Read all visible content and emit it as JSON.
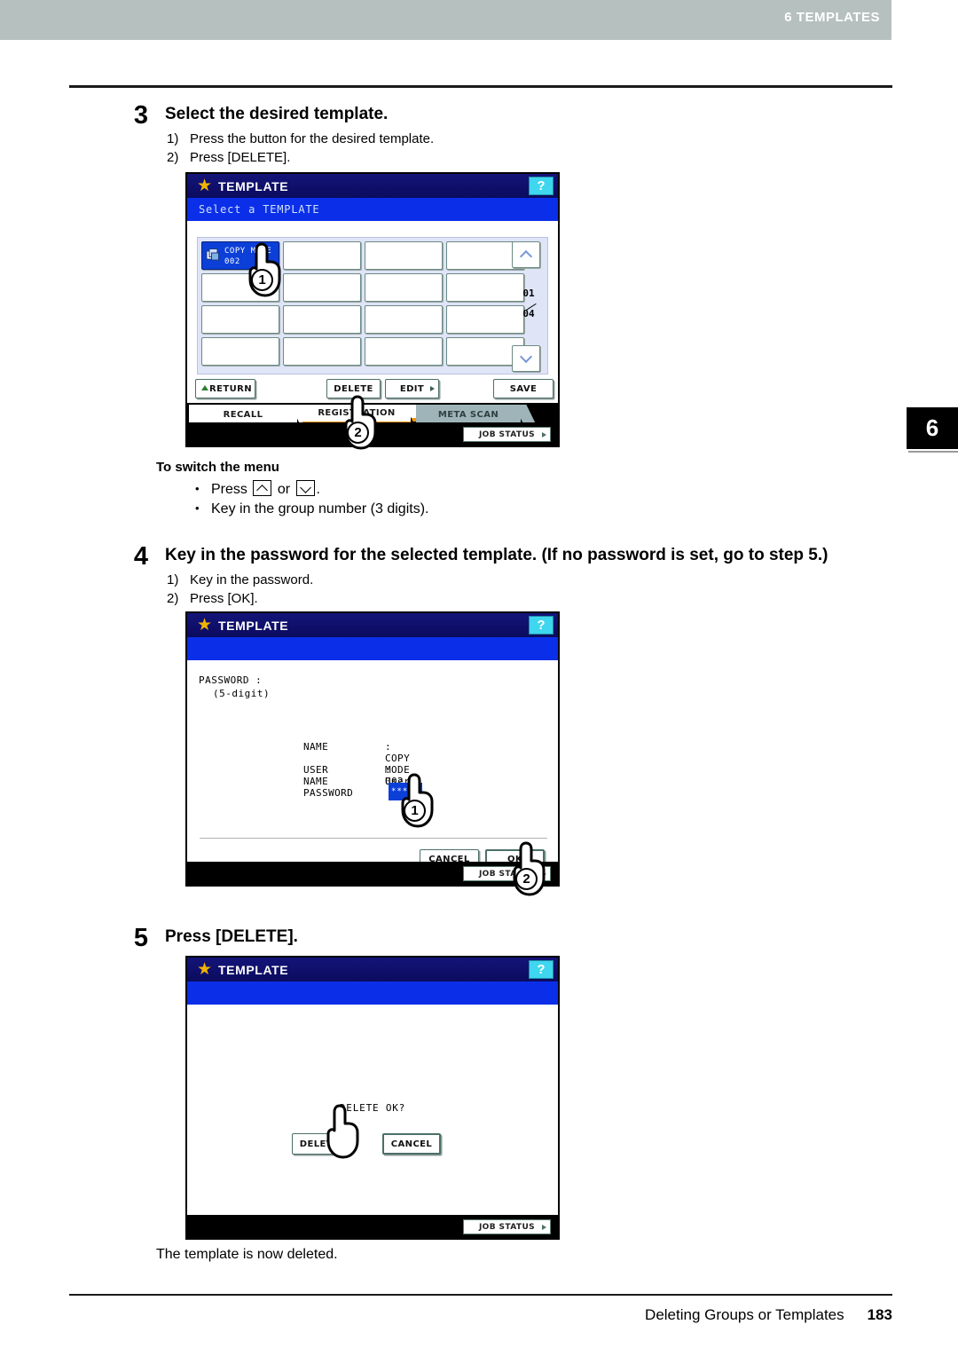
{
  "header": {
    "chapter_label": "6 TEMPLATES",
    "chapter_tab_number": "6"
  },
  "footer": {
    "section_title": "Deleting Groups or Templates",
    "page_number": "183"
  },
  "steps": [
    {
      "number": "3",
      "title": "Select the desired template.",
      "substeps": [
        {
          "marker": "1)",
          "text": "Press the button for the desired template."
        },
        {
          "marker": "2)",
          "text": "Press [DELETE]."
        }
      ]
    },
    {
      "number": "4",
      "title": "Key in the password for the selected template. (If no password is set, go to step 5.)",
      "substeps": [
        {
          "marker": "1)",
          "text": "Key in the password."
        },
        {
          "marker": "2)",
          "text": "Press [OK]."
        }
      ]
    },
    {
      "number": "5",
      "title": "Press [DELETE].",
      "substeps": []
    }
  ],
  "note": {
    "title": "To switch the menu",
    "bullet_press_prefix": "Press",
    "bullet_press_or": "or",
    "bullet_press_suffix": ".",
    "bullet_keyin": "Key in the group number (3 digits)."
  },
  "closing_note": "The template is now deleted.",
  "panel_select": {
    "title": "TEMPLATE",
    "help_label": "?",
    "subtitle": "Select a TEMPLATE",
    "selected_template": {
      "name": "COPY MODE",
      "id": "002"
    },
    "page_current": "01",
    "page_total": "04",
    "buttons": {
      "return": "RETURN",
      "delete": "DELETE",
      "edit": "EDIT",
      "save": "SAVE"
    },
    "tabs": [
      {
        "label": "RECALL",
        "state": "active"
      },
      {
        "label": "REGISTRATION",
        "state": "registration"
      },
      {
        "label": "META SCAN",
        "state": "inactive"
      }
    ],
    "job_status": "JOB STATUS",
    "callouts": [
      {
        "number": "1",
        "target": "selected-template-button"
      },
      {
        "number": "2",
        "target": "delete-button"
      }
    ]
  },
  "panel_password": {
    "title": "TEMPLATE",
    "help_label": "?",
    "subtitle": "",
    "hint_label": "PASSWORD :",
    "hint_detail": "(5-digit)",
    "fields": [
      {
        "key": "NAME",
        "value": ": COPY MODE 002"
      },
      {
        "key": "USER NAME",
        "value": ": User01"
      },
      {
        "key": "PASSWORD",
        "value": "*****"
      }
    ],
    "buttons": {
      "cancel": "CANCEL",
      "ok": "OK"
    },
    "job_status": "JOB STATUS",
    "callouts": [
      {
        "number": "1",
        "target": "password-field"
      },
      {
        "number": "2",
        "target": "ok-button"
      }
    ]
  },
  "panel_confirm": {
    "title": "TEMPLATE",
    "help_label": "?",
    "subtitle": "",
    "message": "DELETE OK?",
    "buttons": {
      "delete": "DELETE",
      "cancel": "CANCEL"
    },
    "job_status": "JOB STATUS"
  },
  "colors": {
    "header_gray": "#b6c0be",
    "lcd_titlebar": "#0b0b5e",
    "lcd_subbar": "#0b2fe8",
    "selection_blue": "#0b3fd8",
    "help_cyan": "#3fd6ef",
    "tab_orange": "#f29400",
    "meta_tab_gray": "#9fb4b8",
    "grid_bg": "#dfe4f7"
  }
}
